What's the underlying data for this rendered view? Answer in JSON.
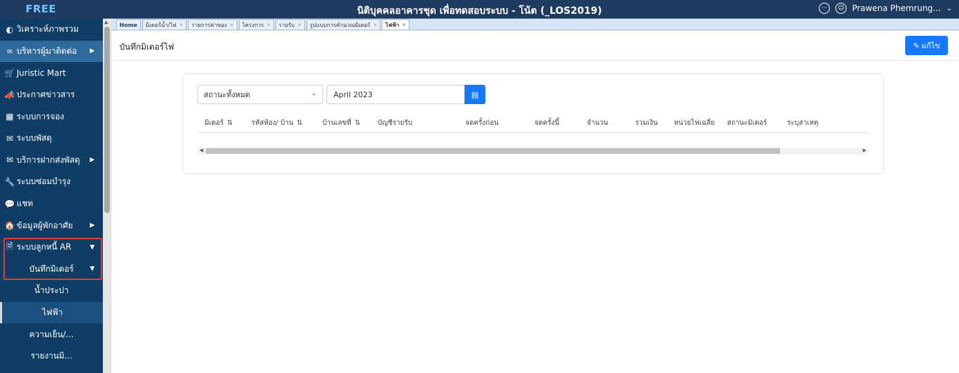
{
  "topbar": {
    "brand": "FREE",
    "title": "นิติบุคคลอาคารชุด เพื่อทดสอบระบบ - โน้ต (_LOS2019)",
    "user_name": "Prawena Phemrung..."
  },
  "sidebar": {
    "items": [
      {
        "icon": "◐",
        "label": "วิเคราะห์ภาพรวม"
      },
      {
        "icon": "∞",
        "label": "บริหารผู้มาติดต่อ",
        "arrow": "▶"
      },
      {
        "icon": "🛒",
        "label": "Juristic Mart"
      },
      {
        "icon": "📣",
        "label": "ประกาศข่าวสาร"
      },
      {
        "icon": "▦",
        "label": "ระบบการจอง"
      },
      {
        "icon": "✉",
        "label": "ระบบพัสดุ"
      },
      {
        "icon": "✉",
        "label": "บริการฝากส่งพัสดุ",
        "arrow": "▶"
      },
      {
        "icon": "🔧",
        "label": "ระบบซ่อมบำรุง"
      },
      {
        "icon": "💬",
        "label": "แชท"
      },
      {
        "icon": "🏠",
        "label": "ข้อมูลผู้พักอาศัย",
        "arrow": "▶"
      },
      {
        "icon": "🗎",
        "label": "ระบบลูกหนี้ AR",
        "arrow": "▼"
      }
    ],
    "sub_item": {
      "label": "บันทึกมิเตอร์",
      "arrow": "▼"
    },
    "sub_items": [
      {
        "label": "น้ำประปา"
      },
      {
        "label": "ไฟฟ้า"
      },
      {
        "label": "ความเย็น/..."
      },
      {
        "label": "รายงานมิ..."
      }
    ]
  },
  "tabs": [
    "Home",
    "มิเตอร์น้ำ/ไฟ",
    "รายการค่าของ",
    "โครงการ",
    "รายรับ",
    "รูปแบบการคำนวณมิเตอร์",
    "ไฟฟ้า"
  ],
  "page": {
    "title": "บันทึกมิเตอร์ไฟ",
    "edit_label": "แก้ไข"
  },
  "filters": {
    "status_value": "สถานะทั้งหมด",
    "month_value": "April 2023"
  },
  "table": {
    "columns": [
      "มิเตอร์",
      "รหัสห้อง/ บ้าน",
      "บ้านเลขที่",
      "บัญชีรายรับ",
      "จดครั้งก่อน",
      "จดครั้งนี้",
      "จำนวน",
      "รวมเงิน",
      "หน่วยไฟเฉลี่ย",
      "สถานะมิเตอร์",
      "ระบุสาเหตุ"
    ],
    "sort_icon": "⇅"
  },
  "colors": {
    "sidebar_bg": "#0f3d66",
    "topbar_bg": "#1f3a5f",
    "accent": "#1677ff",
    "highlight_border": "#e23b3b"
  }
}
